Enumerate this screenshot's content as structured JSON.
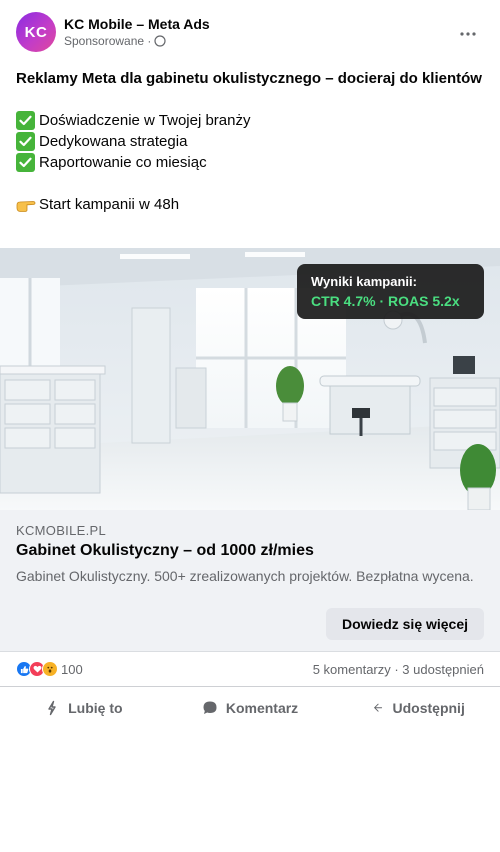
{
  "post": {
    "avatar_initials": "KC",
    "page_name": "KC Mobile – Meta Ads",
    "sponsored_label": "Sponsorowane ·",
    "title": "Reklamy Meta dla gabinetu okulistycznego – docieraj do klientów",
    "benefits": [
      "Doświadczenie w Twojej branży",
      "Dedykowana strategia",
      "Raportowanie co miesiąc"
    ],
    "cta_line": "Start kampanii w 48h"
  },
  "image_overlay": {
    "label": "Wyniki kampanii:",
    "value": "CTR 4.7% · ROAS 5.2x"
  },
  "link": {
    "domain": "KCMOBILE.PL",
    "title": "Gabinet Okulistyczny – od 1000 zł/mies",
    "description": "Gabinet Okulistyczny. 500+ zrealizowanych projektów. Bezpłatna wycena.",
    "cta_label": "Dowiedz się więcej"
  },
  "stats": {
    "reaction_count": "100",
    "comments_shares": "5 komentarzy · 3 udostępnień"
  },
  "actions": {
    "like": "Lubię to",
    "comment": "Komentarz",
    "share": "Udostępnij"
  },
  "icons": {
    "more": "more-options-icon",
    "audience": "globe-icon",
    "check": "check-mark-icon",
    "pointing": "pointing-hand-icon",
    "like": "thumbs-up-icon",
    "comment": "speech-bubble-icon",
    "share": "share-arrow-icon"
  },
  "colors": {
    "accent_green": "#4ade80",
    "check_green": "#46b43a",
    "avatar_gradient": [
      "#8a2be2",
      "#e0489c"
    ]
  }
}
